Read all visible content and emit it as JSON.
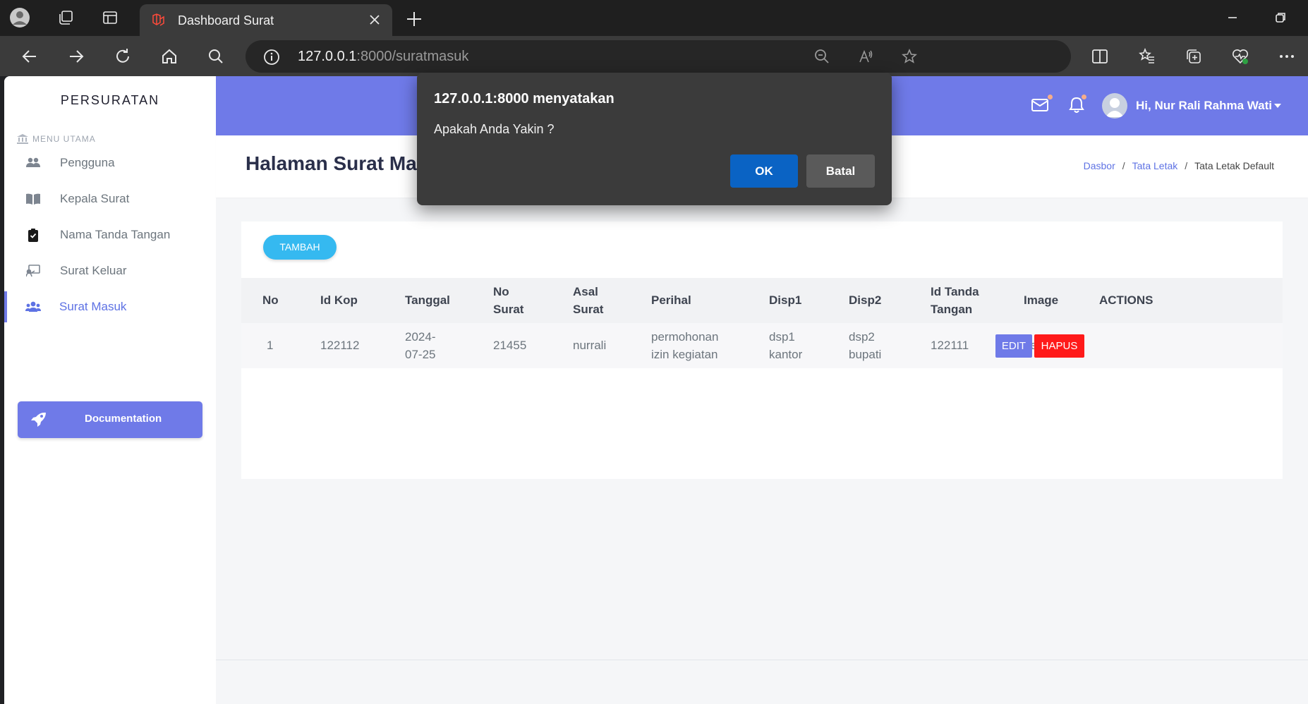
{
  "browser": {
    "tab_title": "Dashboard Surat",
    "url_host": "127.0.0.1",
    "url_path": ":8000/suratmasuk"
  },
  "sidebar": {
    "brand": "PERSURATAN",
    "menu_heading": "MENU UTAMA",
    "items": [
      {
        "label": "Pengguna",
        "icon": "users-icon"
      },
      {
        "label": "Kepala Surat",
        "icon": "book-icon"
      },
      {
        "label": "Nama Tanda Tangan",
        "icon": "clipboard-check-icon"
      },
      {
        "label": "Surat Keluar",
        "icon": "chalkboard-icon"
      },
      {
        "label": "Surat Masuk",
        "icon": "users-group-icon",
        "active": true
      }
    ],
    "doc_button": "Documentation"
  },
  "topnav": {
    "user": "Hi, Nur Rali Rahma Wati"
  },
  "header": {
    "title": "Halaman Surat Ma",
    "breadcrumb": [
      "Dasbor",
      "Tata Letak",
      "Tata Letak Default"
    ]
  },
  "table": {
    "add_button": "TAMBAH",
    "columns": [
      {
        "l1": "No",
        "l2": ""
      },
      {
        "l1": "Id Kop",
        "l2": ""
      },
      {
        "l1": "Tanggal",
        "l2": ""
      },
      {
        "l1": "No",
        "l2": "Surat"
      },
      {
        "l1": "Asal",
        "l2": "Surat"
      },
      {
        "l1": "Perihal",
        "l2": ""
      },
      {
        "l1": "Disp1",
        "l2": ""
      },
      {
        "l1": "Disp2",
        "l2": ""
      },
      {
        "l1": "Id Tanda",
        "l2": "Tangan"
      },
      {
        "l1": "Image",
        "l2": ""
      },
      {
        "l1": "ACTIONS",
        "l2": ""
      }
    ],
    "rows": [
      {
        "no": "1",
        "id_kop": "122112",
        "tanggal_1": "2024-",
        "tanggal_2": "07-25",
        "no_surat": "21455",
        "asal_surat": "nurrali",
        "perihal_1": "permohonan",
        "perihal_2": "izin kegiatan",
        "disp1_1": "dsp1",
        "disp1_2": "kantor",
        "disp2_1": "dsp2",
        "disp2_2": "bupati",
        "id_tanda_tangan": "122111",
        "image": "belum",
        "edit_label": "EDIT",
        "delete_label": "HAPUS"
      }
    ]
  },
  "dialog": {
    "title": "127.0.0.1:8000 menyatakan",
    "message": "Apakah Anda Yakin ?",
    "ok": "OK",
    "cancel": "Batal"
  },
  "colors": {
    "accent": "#6f7ae8",
    "info": "#35b9f0",
    "danger": "#ff1a1a",
    "dialog_ok": "#0a63c4"
  }
}
